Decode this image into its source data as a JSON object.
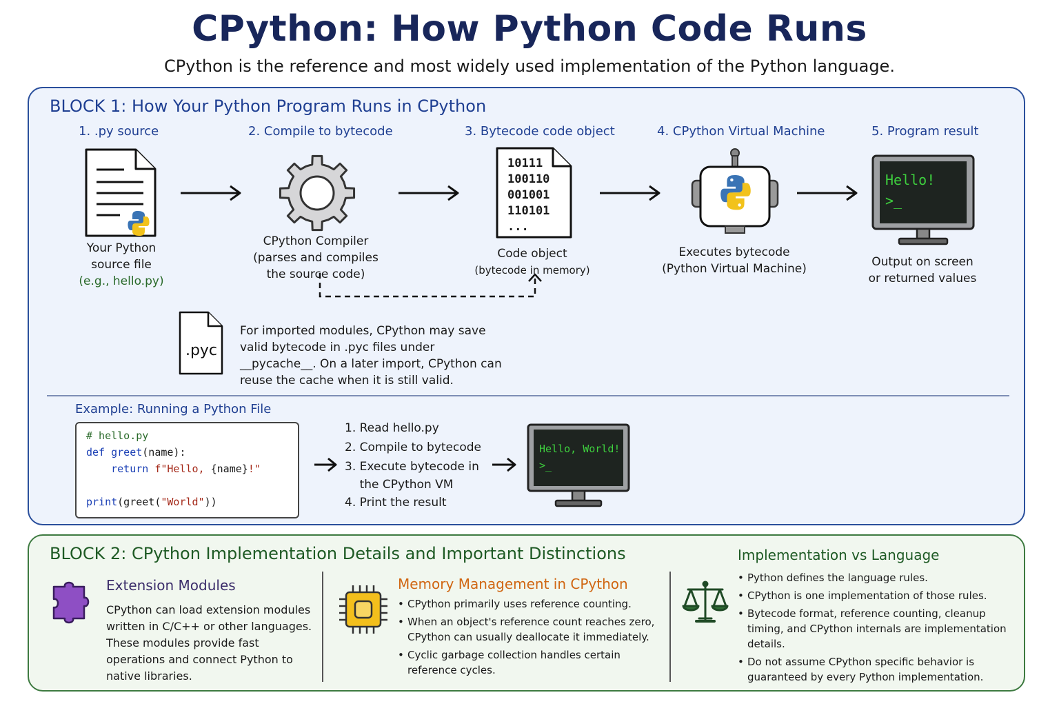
{
  "title": "CPython: How Python Code Runs",
  "subtitle": "CPython is the reference and most widely used implementation of the Python language.",
  "block1": {
    "title": "BLOCK 1: How Your Python Program Runs in CPython",
    "steps": [
      {
        "title": "1. .py source",
        "caption_lines": [
          "Your Python",
          "source file"
        ],
        "caption_green": "(e.g., hello.py)"
      },
      {
        "title": "2. Compile to bytecode",
        "caption_lines": [
          "CPython Compiler",
          "(parses and compiles",
          "the source code)"
        ]
      },
      {
        "title": "3. Bytecode code object",
        "caption_lines": [
          "Code object"
        ],
        "caption_small": "(bytecode in memory)",
        "bytes": [
          "10111",
          "100110",
          "001001",
          "110101",
          "..."
        ]
      },
      {
        "title": "4. CPython Virtual Machine",
        "caption_lines": [
          "Executes bytecode",
          "(Python Virtual Machine)"
        ]
      },
      {
        "title": "5. Program result",
        "caption_lines": [
          "Output on screen",
          "or returned values"
        ],
        "terminal_lines": [
          "Hello!",
          ">_"
        ]
      }
    ],
    "pyc": {
      "label": ".pyc",
      "text": "For imported modules, CPython may save valid bytecode in .pyc files under __pycache__. On a later import, CPython can reuse the cache when it is still valid."
    },
    "example": {
      "title": "Example: Running a Python File",
      "code": {
        "comment": "# hello.py",
        "def_kw": "def",
        "def_name": "greet",
        "def_args": "(name):",
        "return_kw": "return",
        "fstring": "f\"Hello, ",
        "placeholder": "{name}",
        "fstring_end": "!\"",
        "print_kw": "print",
        "print_mid": "(greet(",
        "print_str": "\"World\"",
        "print_end": "))"
      },
      "steps": [
        "1. Read hello.py",
        "2. Compile to bytecode",
        "3. Execute bytecode in",
        "    the CPython VM",
        "4. Print the result"
      ],
      "terminal_lines": [
        "Hello, World!",
        ">_"
      ]
    }
  },
  "block2": {
    "title": "BLOCK 2: CPython Implementation Details and Important Distinctions",
    "extension": {
      "title": "Extension Modules",
      "body": "CPython can load extension modules written in C/C++ or other languages. These modules provide fast operations and connect Python to native libraries."
    },
    "memory": {
      "title": "Memory Management in CPython",
      "bullets": [
        "CPython primarily uses reference counting.",
        "When an object's reference count reaches zero, CPython can usually deallocate it immediately.",
        "Cyclic garbage collection handles certain reference cycles."
      ]
    },
    "impl": {
      "title": "Implementation vs Language",
      "bullets": [
        "Python defines the language rules.",
        "CPython is one implementation of those rules.",
        "Bytecode format, reference counting, cleanup timing, and CPython internals are implementation details.",
        "Do not assume CPython specific behavior is guaranteed by every Python implementation."
      ]
    }
  },
  "colors": {
    "title": "#18265a",
    "block1_border": "#2a4f9c",
    "block1_bg": "#eef3fc",
    "block2_border": "#3d7a40",
    "block2_bg": "#f1f7ef",
    "memory_title": "#d06612",
    "terminal_green": "#3ecf3e"
  },
  "icons": [
    "document-icon",
    "python-logo-icon",
    "gear-icon",
    "bytecode-file-icon",
    "robot-icon",
    "monitor-icon",
    "pyc-file-icon",
    "puzzle-icon",
    "chip-icon",
    "scales-icon"
  ]
}
